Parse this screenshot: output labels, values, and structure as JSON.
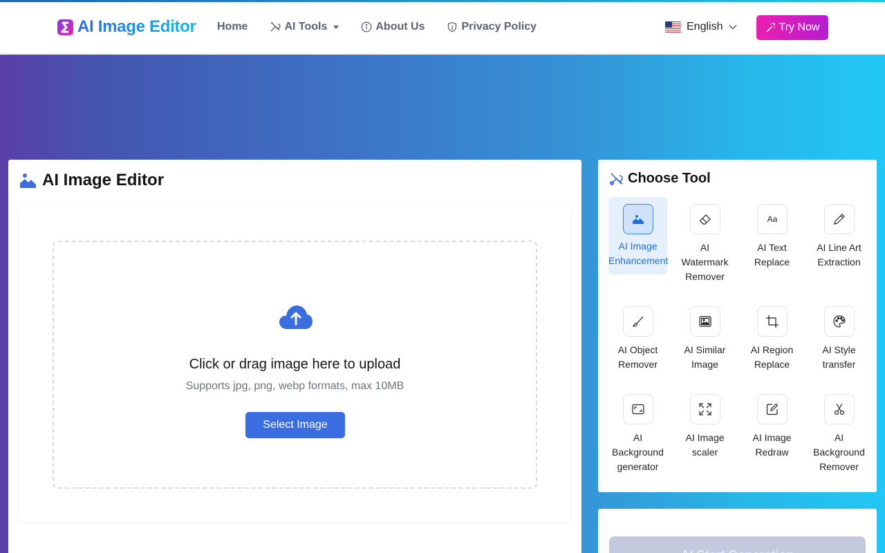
{
  "header": {
    "brand": "AI Image Editor",
    "nav": {
      "home": "Home",
      "ai_tools": "AI Tools",
      "about": "About Us",
      "privacy": "Privacy Policy"
    },
    "language": "English",
    "try_now": "Try Now"
  },
  "editor": {
    "title": "AI Image Editor",
    "upload_title": "Click or drag image here to upload",
    "upload_subtitle": "Supports jpg, png, webp formats, max 10MB",
    "select_button": "Select Image"
  },
  "tools_panel": {
    "title": "Choose Tool",
    "selected": "AI Image Enhancement",
    "tools": [
      {
        "label": "AI Image Enhancement",
        "icon": "image-icon"
      },
      {
        "label": "AI Watermark Remover",
        "icon": "eraser-icon"
      },
      {
        "label": "AI Text Replace",
        "icon": "text-aa-icon"
      },
      {
        "label": "AI Line Art Extraction",
        "icon": "pencil-icon"
      },
      {
        "label": "AI Object Remover",
        "icon": "brush-icon"
      },
      {
        "label": "AI Similar Image",
        "icon": "images-icon"
      },
      {
        "label": "AI Region Replace",
        "icon": "crop-icon"
      },
      {
        "label": "AI Style transfer",
        "icon": "palette-icon"
      },
      {
        "label": "AI Background generator",
        "icon": "frame-icon"
      },
      {
        "label": "AI Image scaler",
        "icon": "expand-icon"
      },
      {
        "label": "AI Image Redraw",
        "icon": "edit-icon"
      },
      {
        "label": "AI Background Remover",
        "icon": "scissors-icon"
      }
    ]
  },
  "generate": {
    "button": "AI Start Generation"
  },
  "colors": {
    "accent_blue": "#3a6ee0",
    "try_now_gradient_start": "#ec1fb0",
    "try_now_gradient_end": "#b51ed0",
    "active_tool_text": "#1b6fd8"
  }
}
